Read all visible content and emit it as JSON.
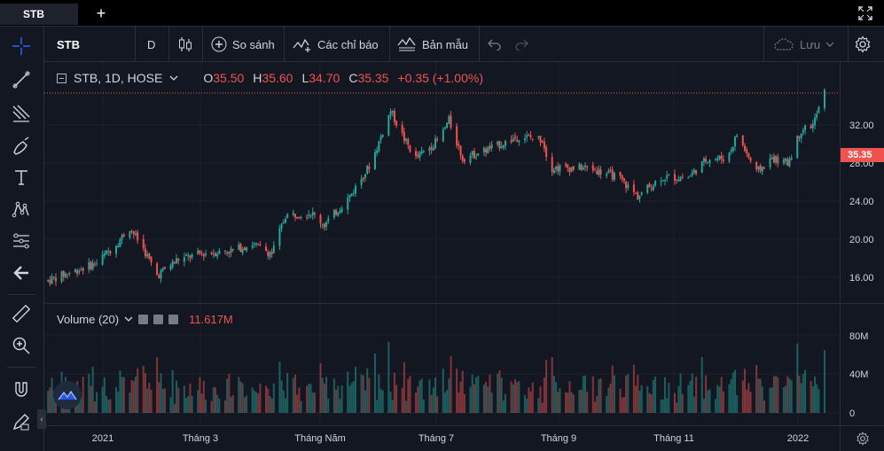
{
  "tabbar": {
    "tab_label": "STB",
    "add_label": "+"
  },
  "toolbar": {
    "symbol": "STB",
    "interval": "D",
    "compare_label": "So sánh",
    "indicators_label": "Các chỉ báo",
    "templates_label": "Bản mẫu",
    "save_label": "Lưu"
  },
  "legend": {
    "title": "STB, 1D, HOSE",
    "open_key": "O",
    "open": "35.50",
    "high_key": "H",
    "high": "35.60",
    "low_key": "L",
    "low": "34.70",
    "close_key": "C",
    "close": "35.35",
    "change": "+0.35 (+1.00%)"
  },
  "volume": {
    "title": "Volume (20)",
    "value": "11.617M"
  },
  "price_axis": {
    "ticks": [
      "32.00",
      "28.00",
      "24.00",
      "20.00",
      "16.00"
    ],
    "last_price": "35.35"
  },
  "volume_axis": {
    "ticks": [
      "80M",
      "40M",
      "0"
    ]
  },
  "time_axis": {
    "ticks": [
      "2021",
      "Tháng 3",
      "Tháng Năm",
      "Tháng 7",
      "Tháng 9",
      "Tháng 11",
      "2022"
    ]
  },
  "colors": {
    "up": "#26a69a",
    "down": "#ef5350",
    "background": "#131722"
  },
  "icons": [
    "crosshair-icon",
    "trend-line-icon",
    "fib-icon",
    "brush-icon",
    "text-icon",
    "pattern-icon",
    "prediction-icon",
    "back-arrow-icon",
    "ruler-icon",
    "zoom-icon",
    "magnet-icon",
    "lock-pencil-icon"
  ],
  "chart_data": {
    "type": "candlestick",
    "symbol": "STB",
    "interval": "1D",
    "exchange": "HOSE",
    "ylim": [
      15,
      38
    ],
    "price_path": [
      [
        "2020-12-20",
        15.6
      ],
      [
        "2021-01-01",
        16.5
      ],
      [
        "2021-01-15",
        17.5
      ],
      [
        "2021-01-25",
        19.5
      ],
      [
        "2021-02-01",
        21.2
      ],
      [
        "2021-02-08",
        19.0
      ],
      [
        "2021-02-15",
        16.2
      ],
      [
        "2021-02-25",
        17.8
      ],
      [
        "2021-03-10",
        18.5
      ],
      [
        "2021-03-25",
        18.8
      ],
      [
        "2021-04-05",
        19.5
      ],
      [
        "2021-04-15",
        18.5
      ],
      [
        "2021-04-22",
        22.5
      ],
      [
        "2021-05-05",
        22.8
      ],
      [
        "2021-05-12",
        21.5
      ],
      [
        "2021-05-25",
        24.5
      ],
      [
        "2021-06-05",
        28.0
      ],
      [
        "2021-06-15",
        33.5
      ],
      [
        "2021-06-22",
        30.5
      ],
      [
        "2021-06-28",
        28.5
      ],
      [
        "2021-07-10",
        30.5
      ],
      [
        "2021-07-15",
        32.5
      ],
      [
        "2021-07-22",
        28.5
      ],
      [
        "2021-08-05",
        29.5
      ],
      [
        "2021-08-20",
        30.8
      ],
      [
        "2021-09-01",
        30.5
      ],
      [
        "2021-09-05",
        27.5
      ],
      [
        "2021-09-25",
        27.5
      ],
      [
        "2021-10-10",
        26.5
      ],
      [
        "2021-10-20",
        24.5
      ],
      [
        "2021-11-01",
        26.5
      ],
      [
        "2021-11-15",
        26.5
      ],
      [
        "2021-11-25",
        28.5
      ],
      [
        "2021-12-05",
        28.5
      ],
      [
        "2021-12-10",
        31.0
      ],
      [
        "2021-12-20",
        27.0
      ],
      [
        "2021-12-28",
        28.5
      ],
      [
        "2022-01-05",
        28.0
      ],
      [
        "2022-01-12",
        31.5
      ],
      [
        "2022-01-18",
        32.0
      ],
      [
        "2022-01-24",
        35.35
      ]
    ],
    "last": {
      "open": 35.5,
      "high": 35.6,
      "low": 34.7,
      "close": 35.35,
      "volume": "11.617M"
    }
  }
}
